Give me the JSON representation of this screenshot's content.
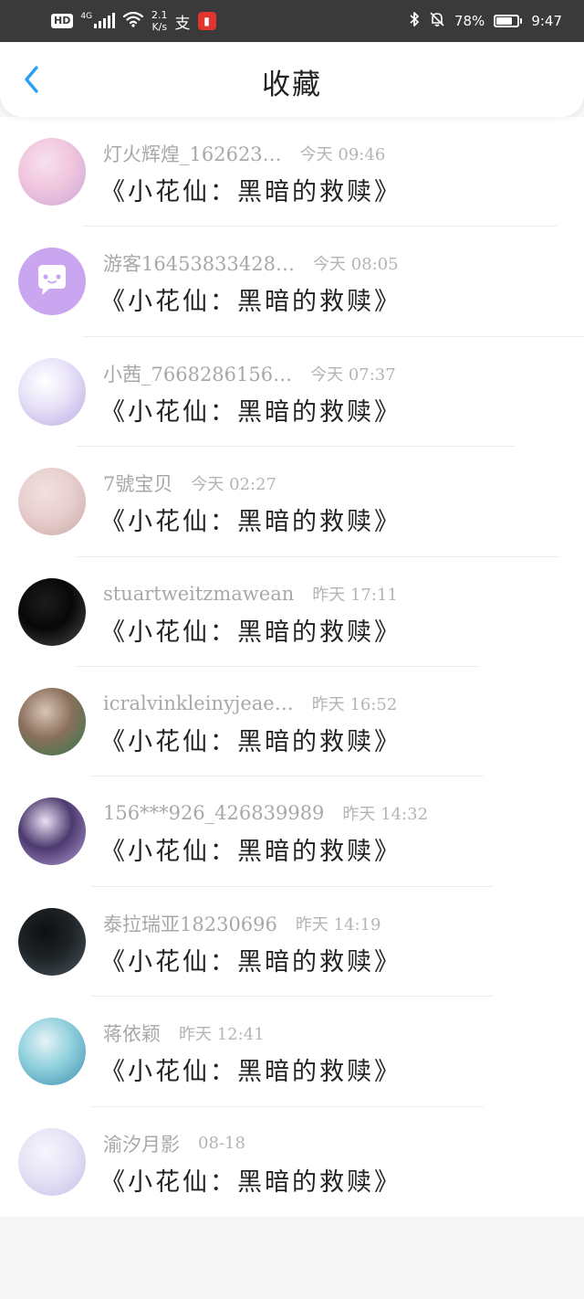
{
  "status_bar": {
    "hd": "HD",
    "network": "4G",
    "speed_value": "2.1",
    "speed_unit": "K/s",
    "alipay_glyph": "支",
    "read_glyph": "▮",
    "bluetooth_glyph": "✱",
    "bell_glyph": "🔕",
    "battery_percent": "78%",
    "battery_level": 0.78,
    "time": "9:47"
  },
  "header": {
    "back_icon": "chevron-left-icon",
    "back_color": "#2a9ff2",
    "title": "收藏"
  },
  "items": [
    {
      "username": "灯火辉煌_162623…",
      "time": "今天 09:46",
      "title": "《小花仙：黑暗的救赎》",
      "avatar_colors": [
        "#f1c6de",
        "#c9a5d6",
        "#f7e1ee"
      ]
    },
    {
      "username": "游客16453833428…",
      "time": "今天 08:05",
      "title": "《小花仙：黑暗的救赎》",
      "avatar_colors": [
        "#caa6f0",
        "#caa6f0",
        "#caa6f0"
      ]
    },
    {
      "username": "小茜_7668286156…",
      "time": "今天 07:37",
      "title": "《小花仙：黑暗的救赎》",
      "avatar_colors": [
        "#e7e1f7",
        "#b7a9e3",
        "#ffffff"
      ]
    },
    {
      "username": "7號宝贝",
      "time": "今天 02:27",
      "title": "《小花仙：黑暗的救赎》",
      "avatar_colors": [
        "#e8cfcf",
        "#c9aaa6",
        "#f1e1df"
      ]
    },
    {
      "username": "stuartweitzmawean",
      "time": "昨天 17:11",
      "title": "《小花仙：黑暗的救赎》",
      "avatar_colors": [
        "#080808",
        "#4a4a4a",
        "#1c1c1c"
      ]
    },
    {
      "username": "icralvinkleinyjeae…",
      "time": "昨天 16:52",
      "title": "《小花仙：黑暗的救赎》",
      "avatar_colors": [
        "#8a6f5c",
        "#2f7a4a",
        "#d9c4b5"
      ]
    },
    {
      "username": "156***926_426839989",
      "time": "昨天 14:32",
      "title": "《小花仙：黑暗的救赎》",
      "avatar_colors": [
        "#4c3a6e",
        "#b49ad6",
        "#e9dff4"
      ]
    },
    {
      "username": "泰拉瑞亚18230696",
      "time": "昨天 14:19",
      "title": "《小花仙：黑暗的救赎》",
      "avatar_colors": [
        "#1e2326",
        "#4a5660",
        "#0d1012"
      ]
    },
    {
      "username": "蒋依颖",
      "time": "昨天 12:41",
      "title": "《小花仙：黑暗的救赎》",
      "avatar_colors": [
        "#8fd0dd",
        "#3f8fb0",
        "#e6f3f6"
      ]
    },
    {
      "username": "渝汐月影",
      "time": "08-18",
      "title": "《小花仙：黑暗的救赎》",
      "avatar_colors": [
        "#e7e3f6",
        "#c7bde8",
        "#f7f4fc"
      ]
    }
  ]
}
